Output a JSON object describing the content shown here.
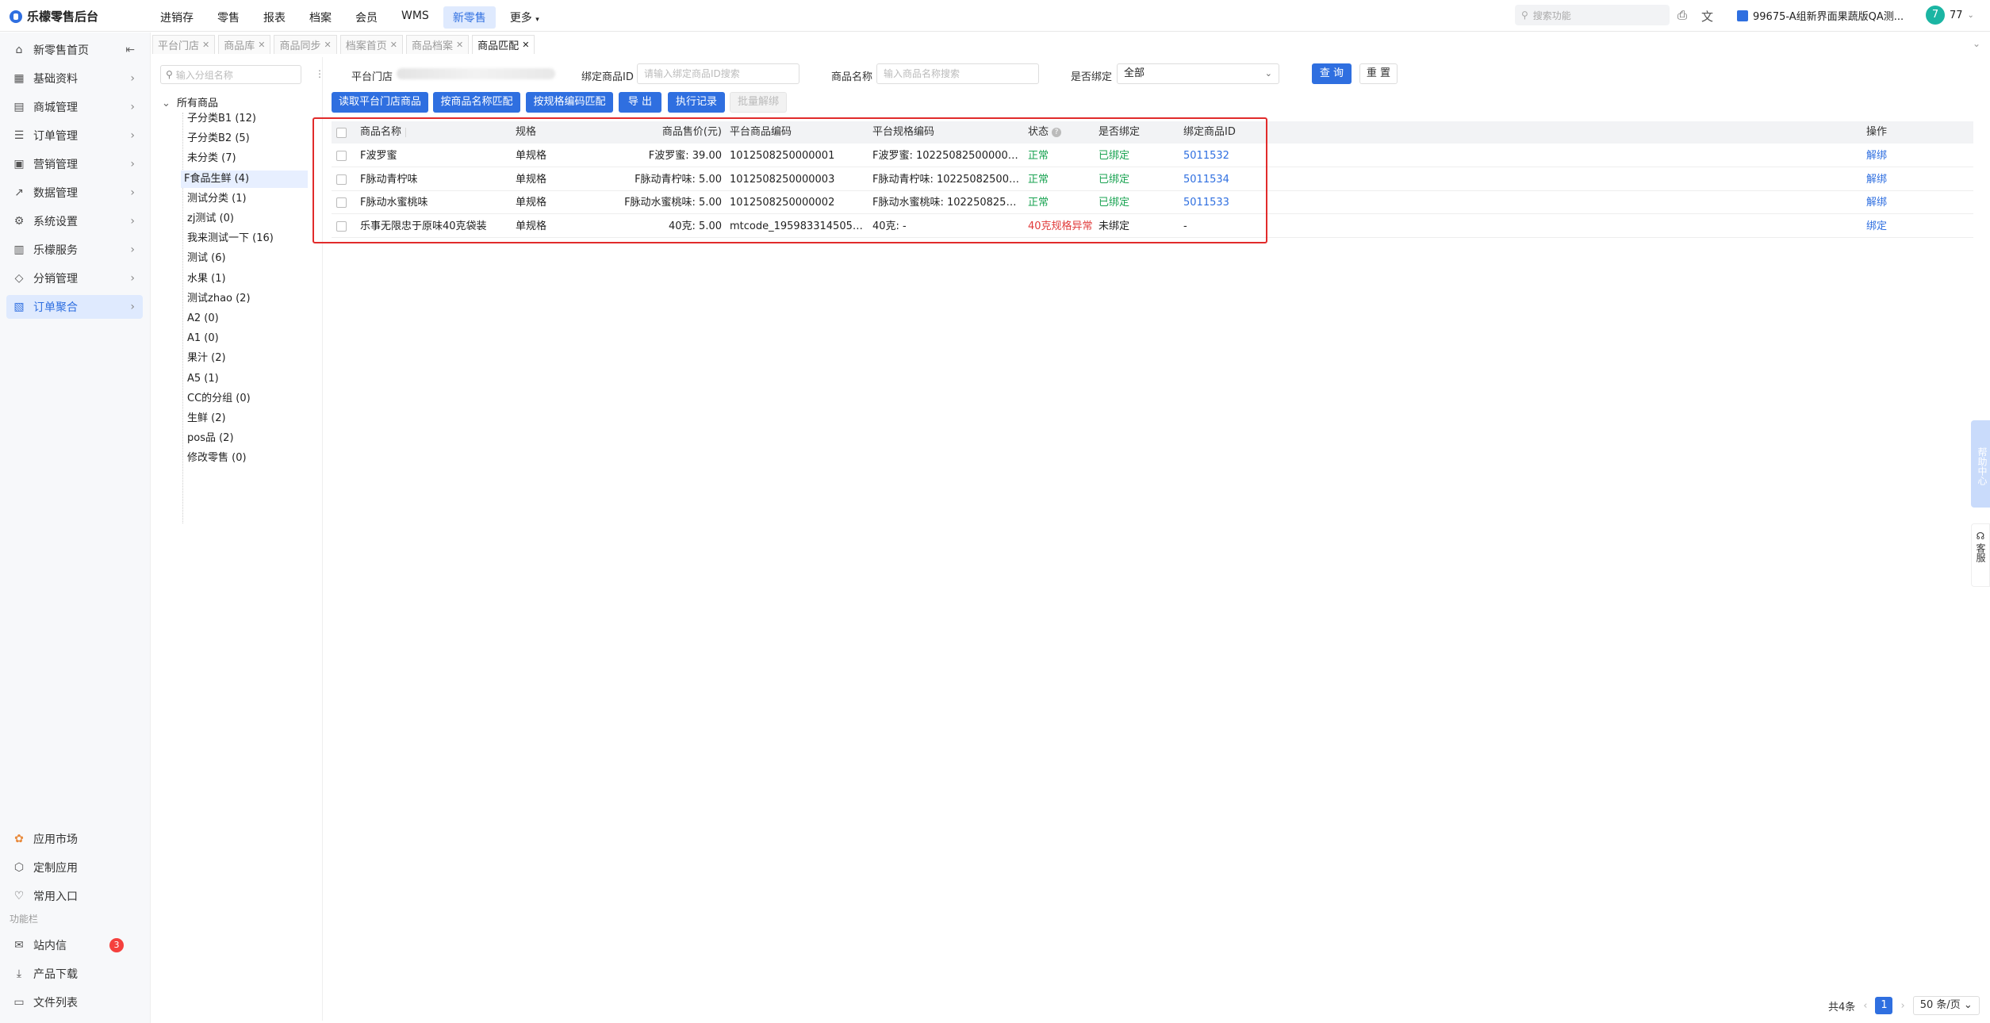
{
  "app": {
    "title": "乐檬零售后台"
  },
  "topnav": [
    "进销存",
    "零售",
    "报表",
    "档案",
    "会员",
    "WMS",
    "新零售",
    "更多"
  ],
  "topnav_active": 6,
  "search": {
    "placeholder": "搜索功能"
  },
  "store": {
    "name": "99675-A组新界面果蔬版QA测..."
  },
  "user": {
    "avatar": "7",
    "name": "77"
  },
  "sidebar": {
    "items": [
      {
        "label": "新零售首页",
        "icon": "home-icon"
      },
      {
        "label": "基础资料",
        "icon": "grid-icon"
      },
      {
        "label": "商城管理",
        "icon": "shop-icon"
      },
      {
        "label": "订单管理",
        "icon": "order-icon"
      },
      {
        "label": "营销管理",
        "icon": "marketing-icon"
      },
      {
        "label": "数据管理",
        "icon": "chart-icon"
      },
      {
        "label": "系统设置",
        "icon": "gear-icon"
      },
      {
        "label": "乐檬服务",
        "icon": "service-icon"
      },
      {
        "label": "分销管理",
        "icon": "distribution-icon"
      },
      {
        "label": "订单聚合",
        "icon": "aggregate-icon"
      }
    ],
    "bottom": [
      {
        "label": "应用市场",
        "icon": "app-market-icon"
      },
      {
        "label": "定制应用",
        "icon": "custom-app-icon"
      },
      {
        "label": "常用入口",
        "icon": "heart-icon"
      }
    ],
    "section_title": "功能栏",
    "func": [
      {
        "label": "站内信",
        "icon": "mail-icon",
        "badge": "3"
      },
      {
        "label": "产品下载",
        "icon": "download-icon"
      },
      {
        "label": "文件列表",
        "icon": "file-list-icon"
      }
    ]
  },
  "tabs": [
    "平台门店",
    "商品库",
    "商品同步",
    "档案首页",
    "商品档案",
    "商品匹配"
  ],
  "tree": {
    "search_placeholder": "输入分组名称",
    "root": "所有商品",
    "nodes": [
      "子分类B1 (12)",
      "子分类B2 (5)",
      "未分类 (7)",
      "F食品生鲜 (4)",
      "测试分类 (1)",
      "zj测试 (0)",
      "我来测试一下 (16)",
      "测试 (6)",
      "水果 (1)",
      "测试zhao (2)",
      "A2 (0)",
      "A1 (0)",
      "果汁 (2)",
      "A5 (1)",
      "CC的分组 (0)",
      "生鲜 (2)",
      "pos品 (2)",
      "修改零售 (0)"
    ]
  },
  "filters": {
    "store_label": "平台门店",
    "bind_id_label": "绑定商品ID",
    "bind_id_placeholder": "请输入绑定商品ID搜索",
    "name_label": "商品名称",
    "name_placeholder": "输入商品名称搜索",
    "bound_label": "是否绑定",
    "bound_value": "全部",
    "query_btn": "查 询",
    "reset_btn": "重 置"
  },
  "actions": [
    "读取平台门店商品",
    "按商品名称匹配",
    "按规格编码匹配",
    "导 出",
    "执行记录",
    "批量解绑"
  ],
  "table": {
    "headers": [
      "商品名称",
      "规格",
      "商品售价(元)",
      "平台商品编码",
      "平台规格编码",
      "状态",
      "是否绑定",
      "绑定商品ID",
      "操作"
    ],
    "rows": [
      {
        "name": "F波罗蜜",
        "spec": "单规格",
        "price": "F波罗蜜: 39.00",
        "code": "1012508250000001",
        "spec_code": "F波罗蜜: 1022508250000001",
        "status": "正常",
        "bound": "已绑定",
        "bind_id": "5011532",
        "op": "解绑"
      },
      {
        "name": "F脉动青柠味",
        "spec": "单规格",
        "price": "F脉动青柠味: 5.00",
        "code": "1012508250000003",
        "spec_code": "F脉动青柠味: 10225082500000...",
        "status": "正常",
        "bound": "已绑定",
        "bind_id": "5011534",
        "op": "解绑"
      },
      {
        "name": "F脉动水蜜桃味",
        "spec": "单规格",
        "price": "F脉动水蜜桃味: 5.00",
        "code": "1012508250000002",
        "spec_code": "F脉动水蜜桃味: 10225082500...",
        "status": "正常",
        "bound": "已绑定",
        "bind_id": "5011533",
        "op": "解绑"
      },
      {
        "name": "乐事无限忠于原味40克袋装",
        "spec": "单规格",
        "price": "40克: 5.00",
        "code": "mtcode_19598331450553...",
        "spec_code": "40克: -",
        "status": "40克规格异常",
        "bound": "未绑定",
        "bind_id": "-",
        "op": "绑定"
      }
    ]
  },
  "float": {
    "help": "帮助中心",
    "service": "客服"
  },
  "pagination": {
    "total": "共4条",
    "page": "1",
    "size": "50 条/页"
  },
  "colors": {
    "accent": "#2f6fe0",
    "success": "#1aa352",
    "danger": "#e13b3b",
    "highlight": "#e12b2b"
  }
}
